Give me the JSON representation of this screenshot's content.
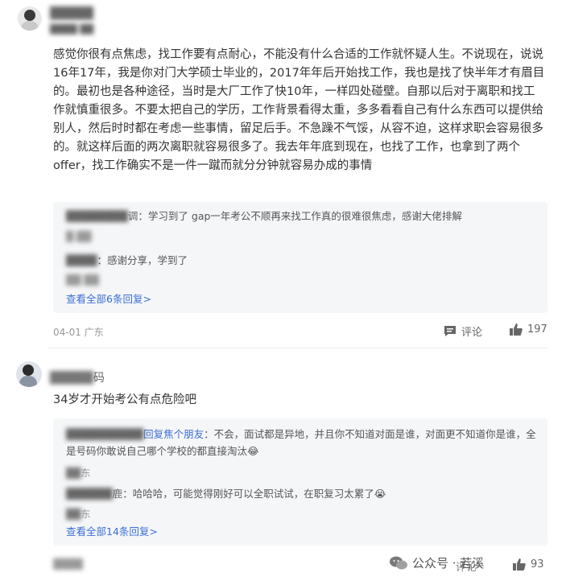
{
  "comment1": {
    "user": "█████",
    "user_sub": "████ ██",
    "text": "感觉你很有点焦虑，找工作要有点耐心，不能没有什么合适的工作就怀疑人生。不说现在，说说16年17年，我是你对门大学硕士毕业的，2017年年后开始找工作，我也是找了快半年才有眉目的。最初也是各种途径，当时是大厂工作了快10年，一样四处碰壁。自那以后对于离职和找工作就慎重很多。不要太把自己的学历，工作背景看得太重，多多看看自己有什么东西可以提供给别人，然后时时都在考虑一些事情，留足后手。不急躁不气馁，从容不迫，这样求职会容易很多的。就这样后面的两次离职就容易很多了。我去年年底到现在，也找了工作，也拿到了两个offer，找工作确实不是一件一蹴而就分分钟就容易办成的事情",
    "replies": [
      {
        "name_hidden": "████████",
        "name_suffix": "调",
        "text": "：学习到了 gap一年考公不顺再来找工作真的很难很焦虑，感谢大佬排解",
        "meta_hidden": "█ ██"
      },
      {
        "name_hidden": "████",
        "name_suffix": "",
        "text": "：感谢分享，学到了",
        "meta_hidden": "██ ██"
      }
    ],
    "view_all": "查看全部6条回复>",
    "date": "04-01 广东",
    "comment_label": "评论",
    "likes": "197"
  },
  "comment2": {
    "user_hidden": "█████",
    "user_suffix": "码",
    "text": "34岁才开始考公有点危险吧",
    "replies": [
      {
        "name_hidden": "██████████",
        "reply_to": "回复焦个朋友",
        "text": "：不会，面试都是异地，并且你不知道对面是谁，对面更不知道你是谁，全是号码你敢说自己哪个学校的都直接淘汰😂",
        "meta": "东"
      },
      {
        "name_hidden": "██████",
        "name_suffix": "鹿",
        "text": "：哈哈哈，可能觉得刚好可以全职试试，在职复习太累了😭",
        "meta": "东"
      }
    ],
    "view_all": "查看全部14条回复>",
    "comment_label": "评论",
    "likes": "93"
  },
  "watermark": {
    "text": "公众号 · 若溪"
  },
  "footer_user_hidden": "████"
}
